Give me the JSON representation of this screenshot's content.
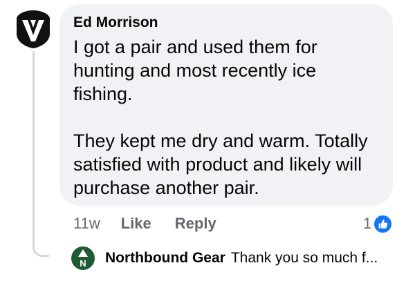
{
  "comment": {
    "author": "Ed Morrison",
    "paragraphs": [
      "I got a pair and used them for hunting and most recently ice fishing.",
      "They kept me dry and warm. Totally satisfied with product and likely will purchase another pair."
    ],
    "time": "11w",
    "like_label": "Like",
    "reply_label": "Reply",
    "reaction_count": "1",
    "reaction_icon": "like-icon"
  },
  "reply": {
    "author": "Northbound Gear",
    "avatar_letter": "N",
    "preview": "Thank you so much f..."
  },
  "colors": {
    "bubble": "#f0f2f5",
    "meta_text": "#65676b",
    "like_blue": "#1877f2",
    "brand_green": "#1e5b34"
  }
}
